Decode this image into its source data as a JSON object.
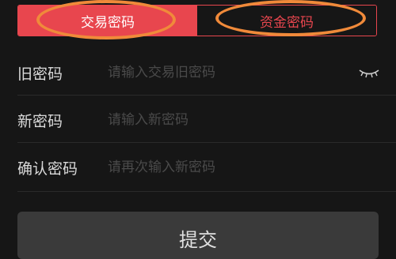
{
  "tabs": [
    {
      "label": "交易密码",
      "active": true
    },
    {
      "label": "资金密码",
      "active": false
    }
  ],
  "form": {
    "old_password": {
      "label": "旧密码",
      "placeholder": "请输入交易旧密码",
      "value": ""
    },
    "new_password": {
      "label": "新密码",
      "placeholder": "请输入新密码",
      "value": ""
    },
    "confirm_password": {
      "label": "确认密码",
      "placeholder": "请再次输入新密码",
      "value": ""
    }
  },
  "icons": {
    "toggle_visibility": "eye-closed-icon"
  },
  "submit_label": "提交",
  "colors": {
    "accent": "#e8464e",
    "highlight_ring": "#f08a3a",
    "background": "#161616"
  }
}
